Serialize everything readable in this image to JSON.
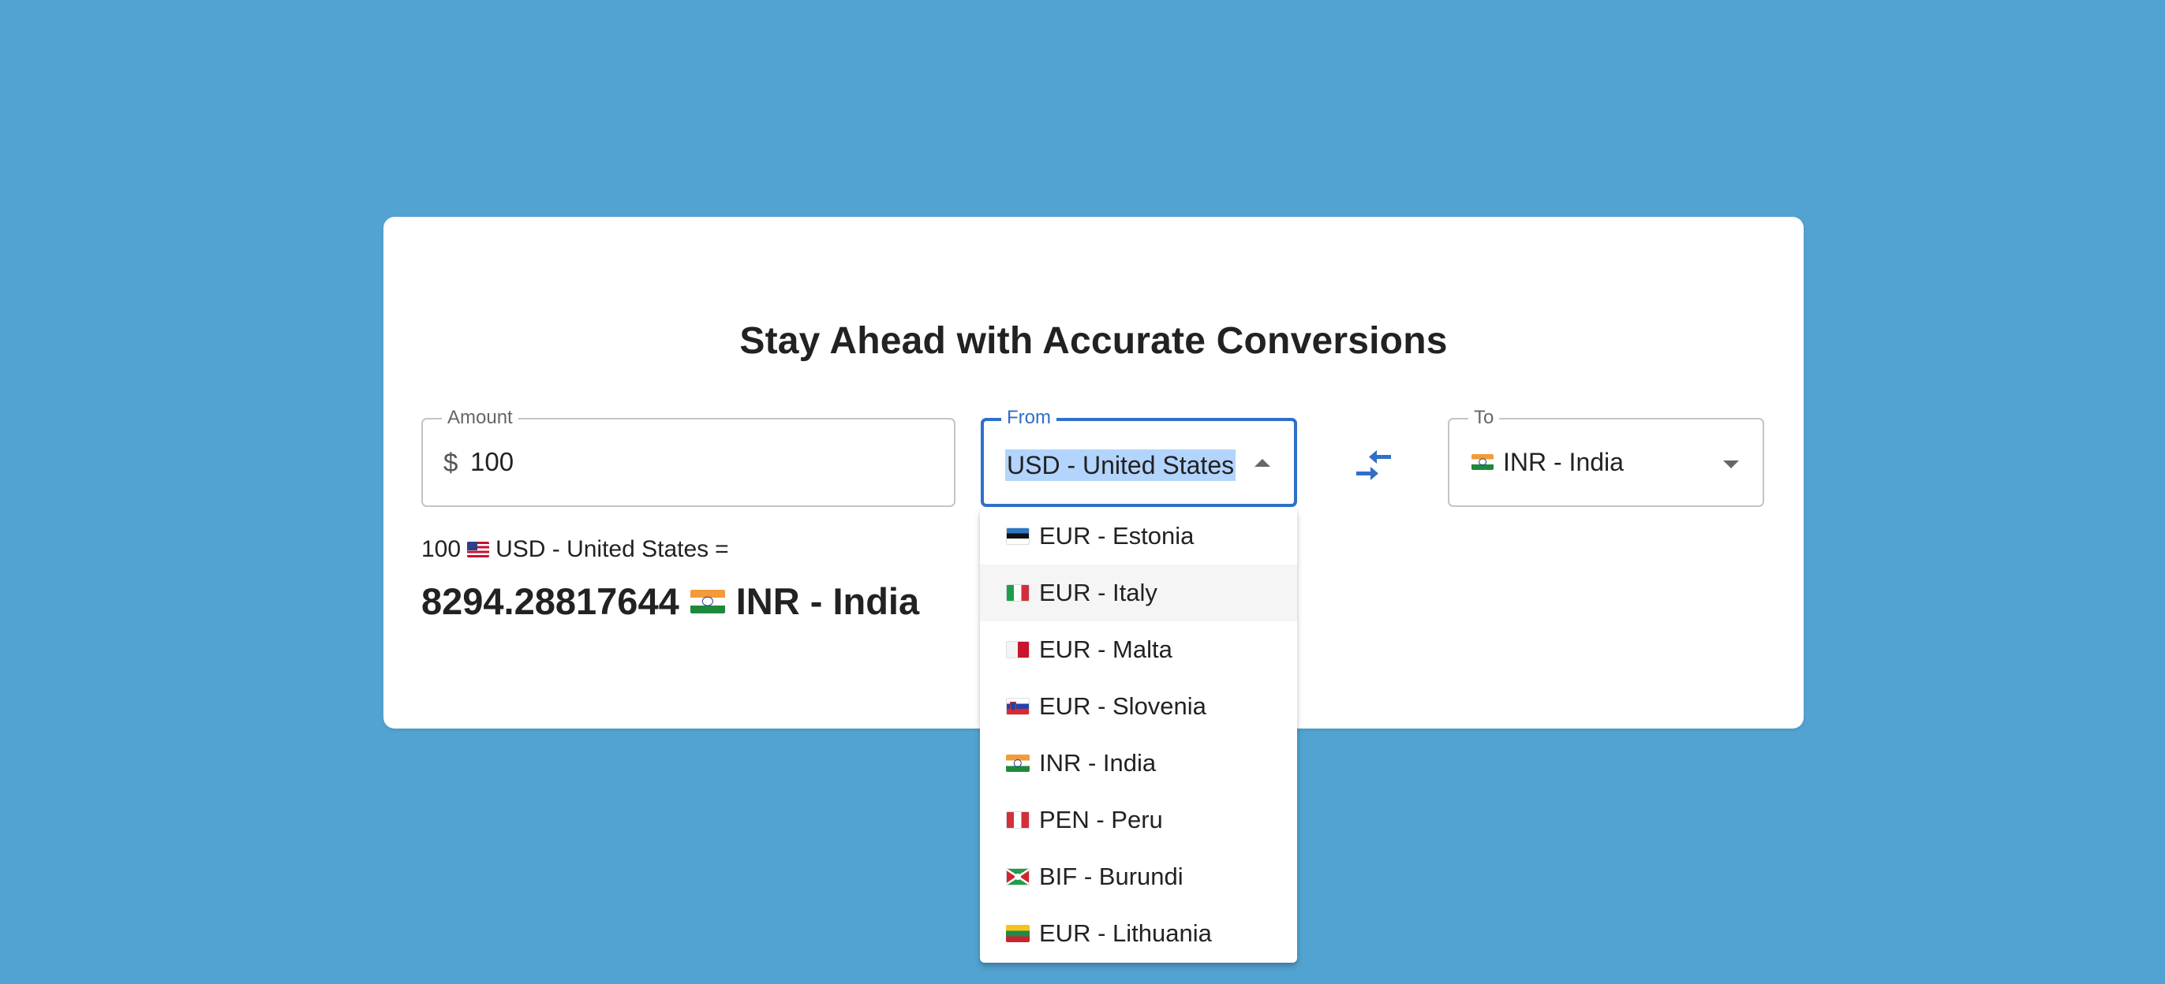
{
  "card": {
    "title": "Stay Ahead with Accurate Conversions"
  },
  "amount_field": {
    "label": "Amount",
    "symbol": "$",
    "value": "100"
  },
  "from_field": {
    "label": "From",
    "value": "USD - United States",
    "state": "open"
  },
  "to_field": {
    "label": "To",
    "flag": "flag-india-icon",
    "value": "INR - India"
  },
  "swap_button": {
    "icon": "swap-arrows-icon",
    "color": "#2e6fc9"
  },
  "result": {
    "amount": "100",
    "from_label": "USD - United States",
    "equals": "=",
    "converted_value": "8294.28817644",
    "to_label": "INR - India"
  },
  "dropdown": {
    "options": [
      {
        "flag": "flag-estonia-icon",
        "label": "EUR - Estonia"
      },
      {
        "flag": "flag-italy-icon",
        "label": "EUR - Italy"
      },
      {
        "flag": "flag-malta-icon",
        "label": "EUR - Malta"
      },
      {
        "flag": "flag-slovenia-icon",
        "label": "EUR - Slovenia"
      },
      {
        "flag": "flag-india-icon",
        "label": "INR - India"
      },
      {
        "flag": "flag-peru-icon",
        "label": "PEN - Peru"
      },
      {
        "flag": "flag-burundi-icon",
        "label": "BIF - Burundi"
      },
      {
        "flag": "flag-lithuania-icon",
        "label": "EUR - Lithuania"
      }
    ],
    "highlighted_label": "EUR - Italy"
  },
  "colors": {
    "background": "#52a3d1",
    "accent": "#2e6fc9",
    "selection": "#b3d4fc"
  }
}
